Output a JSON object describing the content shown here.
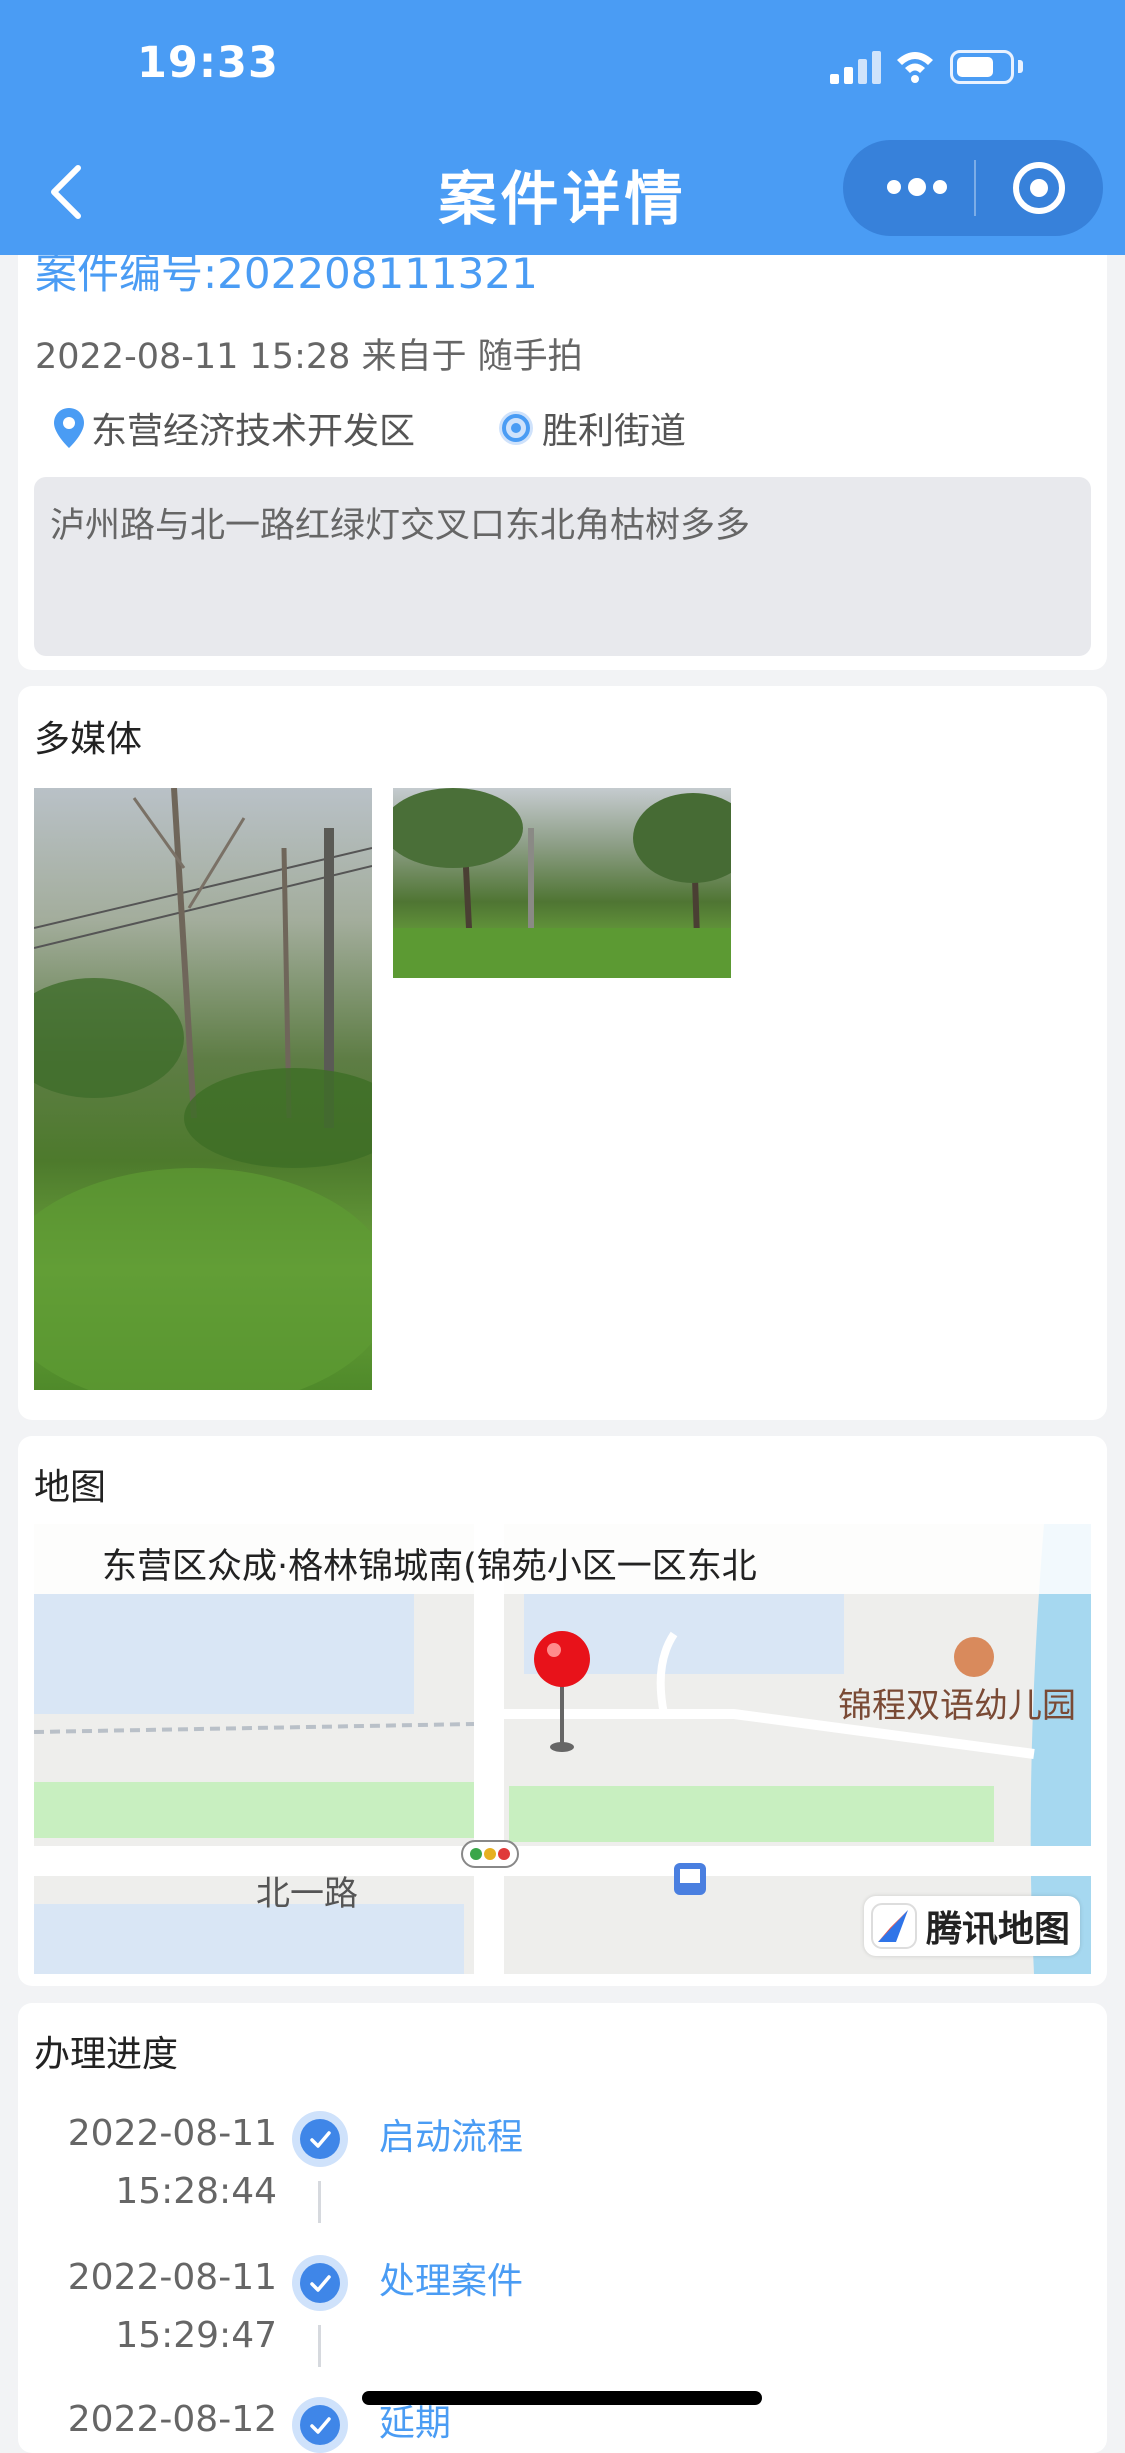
{
  "status_bar": {
    "time": "19:33"
  },
  "nav": {
    "title": "案件详情"
  },
  "case": {
    "number": "案件编号:202208111321",
    "meta": "2022-08-11 15:28 来自于 随手拍",
    "district": "东营经济技术开发区",
    "street": "胜利街道",
    "description": "泸州路与北一路红绿灯交叉口东北角枯树多多"
  },
  "media": {
    "title": "多媒体"
  },
  "map": {
    "title": "地图",
    "address": "东营区众成·格林锦城南(锦苑小区一区东北",
    "poi": "锦程双语幼儿园",
    "road": "北一路",
    "brand": "腾讯地图"
  },
  "progress": {
    "title": "办理进度",
    "steps": [
      {
        "date": "2022-08-11",
        "time": "15:28:44",
        "label": "启动流程"
      },
      {
        "date": "2022-08-11",
        "time": "15:29:47",
        "label": "处理案件"
      },
      {
        "date": "2022-08-12",
        "time": "",
        "label": "延期"
      }
    ]
  },
  "colors": {
    "accent": "#4a9cf4",
    "header": "#4a9cf4",
    "check": "#3f86e8"
  }
}
